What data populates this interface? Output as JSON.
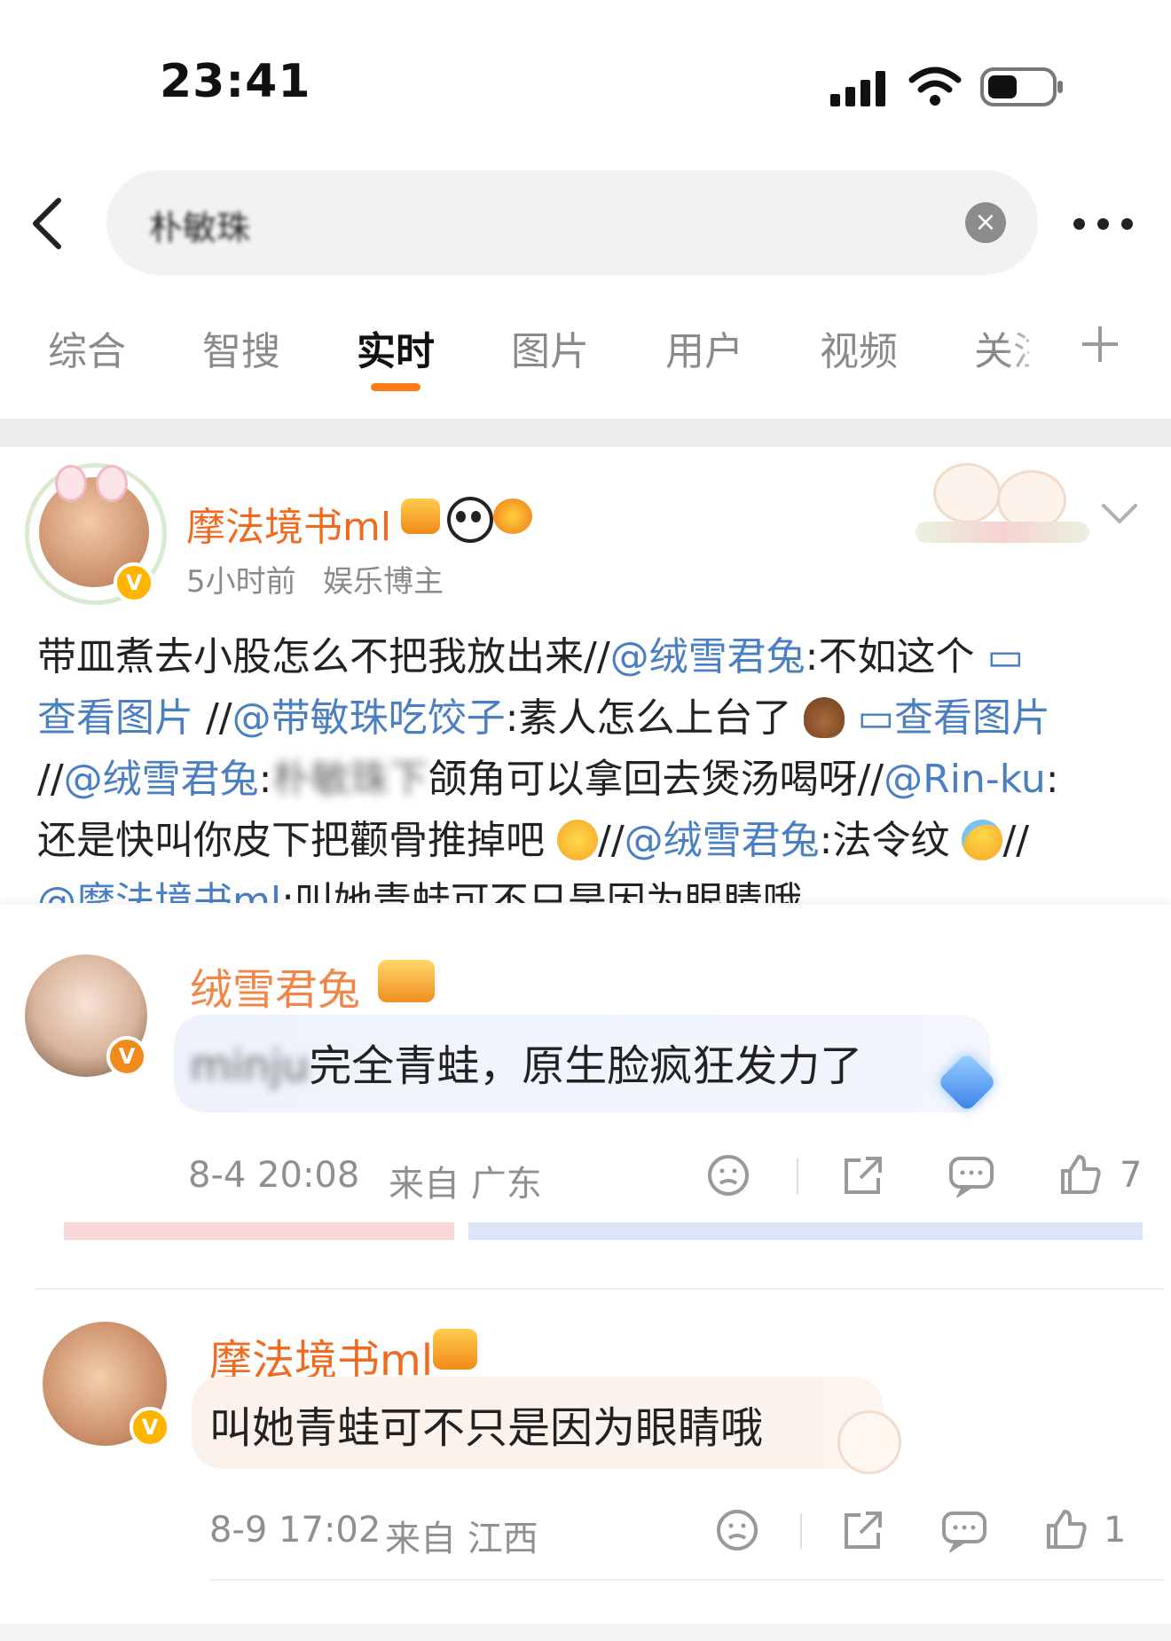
{
  "status_bar": {
    "time": "23:41"
  },
  "search": {
    "query": "朴敏珠"
  },
  "tabs": [
    {
      "label": "综合"
    },
    {
      "label": "智搜"
    },
    {
      "label": "实时"
    },
    {
      "label": "图片"
    },
    {
      "label": "用户"
    },
    {
      "label": "视频"
    },
    {
      "label": "关注"
    }
  ],
  "post": {
    "author": "摩法境书ml",
    "time": "5小时前",
    "tag": "娱乐博主",
    "text": {
      "l1a": "带皿煮去小股怎么不把我放出来//",
      "l1b": "@绒雪君兔",
      "l1c": ":不如这个 ",
      "view_image": "查看图片",
      "l2a": " //",
      "l2b": "@带敏珠吃饺子",
      "l2c": ":素人怎么上台了",
      "view_image2": "查看图片",
      "l3a": "//",
      "l3b": "@绒雪君兔",
      "l3c": ":",
      "l3blur": "朴敏珠下",
      "l3d": "颌角可以拿回去煲汤喝呀//",
      "l3e": "@Rin-ku",
      "l3f": ":",
      "l4a": "还是快叫你皮下把颧骨推掉吧",
      "l4b": "//",
      "l4c": "@绒雪君兔",
      "l4d": ":法令纹",
      "l4e": "//",
      "l5a": "@摩法境书ml",
      "l5b": ":叫她青蛙可不只是因为眼睛哦"
    }
  },
  "comments": [
    {
      "author": "绒雪君兔",
      "text_blur": "minju",
      "text": "完全青蛙，原生脸疯狂发力了",
      "date": "8-4 20:08",
      "location": "来自 广东",
      "likes": "7"
    },
    {
      "author": "摩法境书ml",
      "text": "叫她青蛙可不只是因为眼睛哦",
      "date": "8-9 17:02",
      "location": "来自 江西",
      "likes": "1"
    }
  ],
  "colors": {
    "accent": "#ff7a1a",
    "name_orange": "#f06a1f",
    "link_blue": "#4a7fc1",
    "verified_gold": "#ffb400"
  }
}
